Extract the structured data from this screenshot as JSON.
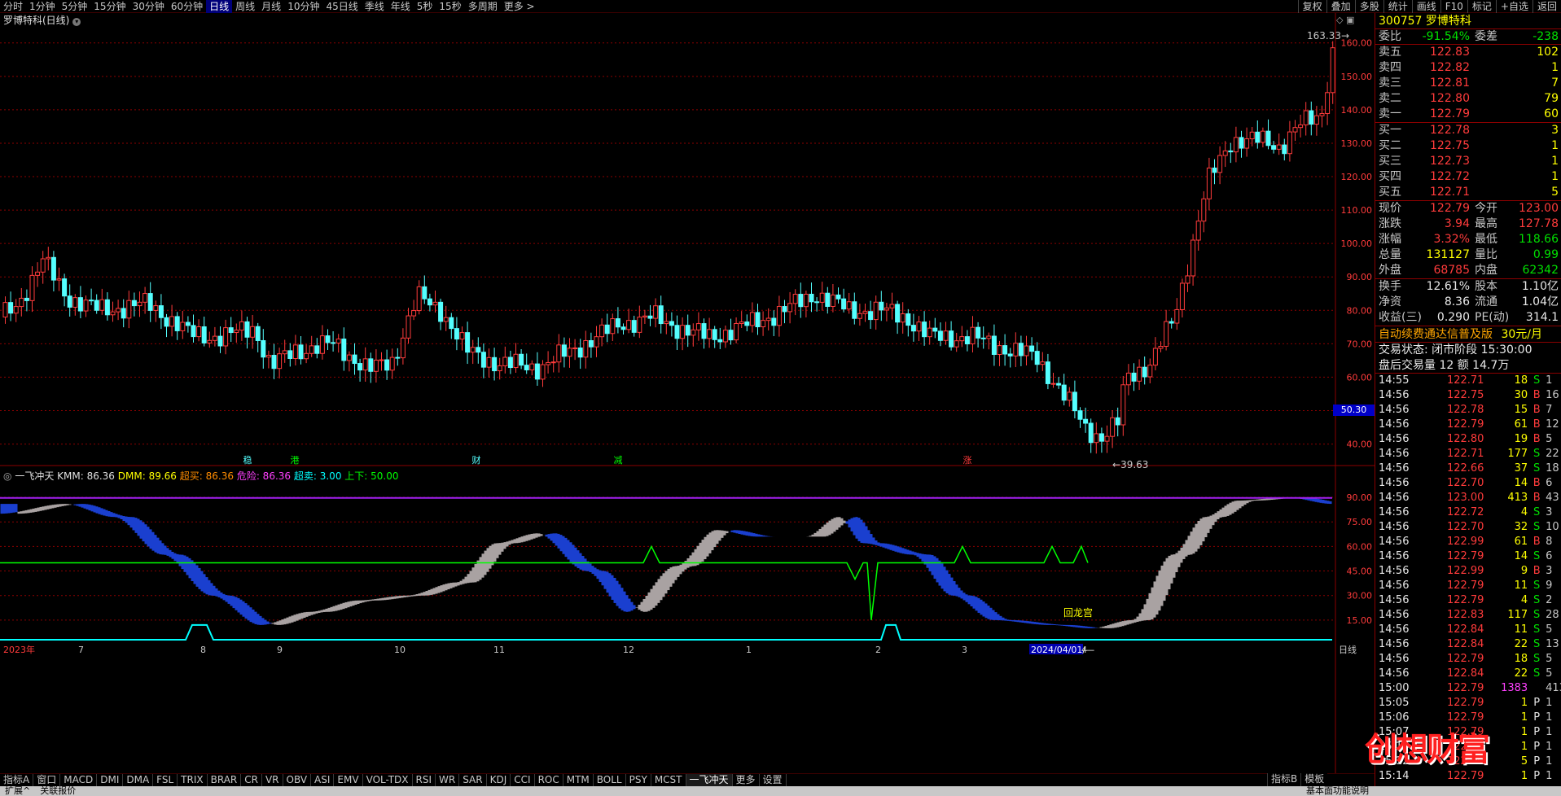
{
  "toolbar": {
    "periods": [
      "分时",
      "1分钟",
      "5分钟",
      "15分钟",
      "30分钟",
      "60分钟",
      "日线",
      "周线",
      "月线",
      "10分钟",
      "45日线",
      "季线",
      "年线",
      "5秒",
      "15秒",
      "多周期",
      "更多 >"
    ],
    "active_period": "日线",
    "tools": [
      "复权",
      "叠加",
      "多股",
      "统计",
      "画线",
      "F10",
      "标记",
      "+自选",
      "返回"
    ]
  },
  "chart": {
    "title": "罗博特科(日线)",
    "high_label": "163.33",
    "low_label": "39.63",
    "current_price_tag": "50.30",
    "y_ticks": [
      "160.00",
      "150.00",
      "140.00",
      "130.00",
      "120.00",
      "110.00",
      "100.00",
      "90.00",
      "80.00",
      "70.00",
      "60.00",
      "50.00",
      "40.00"
    ],
    "event_markers": [
      "稳",
      "港",
      "财",
      "减",
      "涨"
    ],
    "indicator": {
      "name": "一飞冲天",
      "kmm": "KMM: 86.36",
      "dmm": "DMM: 89.66",
      "overbuy": "超买: 86.36",
      "danger": "危险: 86.36",
      "oversell": "超卖: 3.00",
      "updown": "上下: 50.00",
      "y_ticks": [
        "90.00",
        "75.00",
        "60.00",
        "45.00",
        "30.00",
        "15.00"
      ],
      "annotation": "回龙宫"
    },
    "x_labels": [
      "2023年",
      "7",
      "8",
      "9",
      "10",
      "11",
      "12",
      "1",
      "2",
      "3",
      "2024/04/01/—",
      "4"
    ],
    "period_label": "日线"
  },
  "indicator_tabs": [
    "指标A",
    "窗口",
    "MACD",
    "DMI",
    "DMA",
    "FSL",
    "TRIX",
    "BRAR",
    "CR",
    "VR",
    "OBV",
    "ASI",
    "EMV",
    "VOL-TDX",
    "RSI",
    "WR",
    "SAR",
    "KDJ",
    "CCI",
    "ROC",
    "MTM",
    "BOLL",
    "PSY",
    "MCST",
    "一飞冲天",
    "更多",
    "设置"
  ],
  "indicator_tabs_right": [
    "指标B",
    "模板"
  ],
  "status_bar": [
    "扩展^",
    "关联报价"
  ],
  "status_bar_right": "基本面功能说明",
  "quote": {
    "code": "300757",
    "name": "罗博特科",
    "weibi_label": "委比",
    "weibi": "-91.54%",
    "weicha_label": "委差",
    "weicha": "-238",
    "asks": [
      {
        "label": "卖五",
        "price": "122.83",
        "vol": "102"
      },
      {
        "label": "卖四",
        "price": "122.82",
        "vol": "1"
      },
      {
        "label": "卖三",
        "price": "122.81",
        "vol": "7"
      },
      {
        "label": "卖二",
        "price": "122.80",
        "vol": "79"
      },
      {
        "label": "卖一",
        "price": "122.79",
        "vol": "60"
      }
    ],
    "bids": [
      {
        "label": "买一",
        "price": "122.78",
        "vol": "3"
      },
      {
        "label": "买二",
        "price": "122.75",
        "vol": "1"
      },
      {
        "label": "买三",
        "price": "122.73",
        "vol": "1"
      },
      {
        "label": "买四",
        "price": "122.72",
        "vol": "1"
      },
      {
        "label": "买五",
        "price": "122.71",
        "vol": "5"
      }
    ],
    "stats": [
      {
        "l1": "现价",
        "v1": "122.79",
        "c1": "red",
        "l2": "今开",
        "v2": "123.00",
        "c2": "red"
      },
      {
        "l1": "涨跌",
        "v1": "3.94",
        "c1": "red",
        "l2": "最高",
        "v2": "127.78",
        "c2": "red"
      },
      {
        "l1": "涨幅",
        "v1": "3.32%",
        "c1": "red",
        "l2": "最低",
        "v2": "118.66",
        "c2": "green"
      },
      {
        "l1": "总量",
        "v1": "131127",
        "c1": "yellow",
        "l2": "量比",
        "v2": "0.99",
        "c2": "green"
      },
      {
        "l1": "外盘",
        "v1": "68785",
        "c1": "red",
        "l2": "内盘",
        "v2": "62342",
        "c2": "green"
      }
    ],
    "stats2": [
      {
        "l1": "换手",
        "v1": "12.61%",
        "l2": "股本",
        "v2": "1.10亿"
      },
      {
        "l1": "净资",
        "v1": "8.36",
        "l2": "流通",
        "v2": "1.04亿"
      },
      {
        "l1": "收益(三)",
        "v1": "0.290",
        "l2": "PE(动)",
        "v2": "314.1"
      }
    ],
    "promo": "自动续费通达信普及版",
    "promo_price": "30元/月",
    "trade_state": "交易状态: 闭市阶段 15:30:00",
    "after_hours": "盘后交易量 12 额 14.7万"
  },
  "ticks": [
    {
      "t": "14:55",
      "p": "122.71",
      "q": "18",
      "s": "S",
      "n": "1"
    },
    {
      "t": "14:56",
      "p": "122.75",
      "q": "30",
      "s": "B",
      "n": "16"
    },
    {
      "t": "14:56",
      "p": "122.78",
      "q": "15",
      "s": "B",
      "n": "7"
    },
    {
      "t": "14:56",
      "p": "122.79",
      "q": "61",
      "s": "B",
      "n": "12"
    },
    {
      "t": "14:56",
      "p": "122.80",
      "q": "19",
      "s": "B",
      "n": "5"
    },
    {
      "t": "14:56",
      "p": "122.71",
      "q": "177",
      "s": "S",
      "n": "22"
    },
    {
      "t": "14:56",
      "p": "122.66",
      "q": "37",
      "s": "S",
      "n": "18"
    },
    {
      "t": "14:56",
      "p": "122.70",
      "q": "14",
      "s": "B",
      "n": "6"
    },
    {
      "t": "14:56",
      "p": "123.00",
      "q": "413",
      "s": "B",
      "n": "43"
    },
    {
      "t": "14:56",
      "p": "122.72",
      "q": "4",
      "s": "S",
      "n": "3"
    },
    {
      "t": "14:56",
      "p": "122.70",
      "q": "32",
      "s": "S",
      "n": "10"
    },
    {
      "t": "14:56",
      "p": "122.99",
      "q": "61",
      "s": "B",
      "n": "8"
    },
    {
      "t": "14:56",
      "p": "122.79",
      "q": "14",
      "s": "S",
      "n": "6"
    },
    {
      "t": "14:56",
      "p": "122.99",
      "q": "9",
      "s": "B",
      "n": "3"
    },
    {
      "t": "14:56",
      "p": "122.79",
      "q": "11",
      "s": "S",
      "n": "9"
    },
    {
      "t": "14:56",
      "p": "122.79",
      "q": "4",
      "s": "S",
      "n": "2"
    },
    {
      "t": "14:56",
      "p": "122.83",
      "q": "117",
      "s": "S",
      "n": "28"
    },
    {
      "t": "14:56",
      "p": "122.84",
      "q": "11",
      "s": "S",
      "n": "5"
    },
    {
      "t": "14:56",
      "p": "122.84",
      "q": "22",
      "s": "S",
      "n": "13"
    },
    {
      "t": "14:56",
      "p": "122.79",
      "q": "18",
      "s": "S",
      "n": "5"
    },
    {
      "t": "14:56",
      "p": "122.84",
      "q": "22",
      "s": "S",
      "n": "5"
    },
    {
      "t": "15:00",
      "p": "122.79",
      "q": "1383",
      "s": "",
      "n": "413"
    },
    {
      "t": "15:05",
      "p": "122.79",
      "q": "1",
      "s": "P",
      "n": "1"
    },
    {
      "t": "15:06",
      "p": "122.79",
      "q": "1",
      "s": "P",
      "n": "1"
    },
    {
      "t": "15:07",
      "p": "122.79",
      "q": "1",
      "s": "P",
      "n": "1"
    },
    {
      "t": "15:10",
      "p": "122.79",
      "q": "1",
      "s": "P",
      "n": "1"
    },
    {
      "t": "15:12",
      "p": "122.79",
      "q": "5",
      "s": "P",
      "n": "1"
    },
    {
      "t": "15:14",
      "p": "122.79",
      "q": "1",
      "s": "P",
      "n": "1"
    }
  ],
  "watermark": "创想财富",
  "colors": {
    "up": "#ff3b3b",
    "down": "#54ffff",
    "grid": "#8b0000",
    "purple_line": "#a020f0",
    "green_line": "#00ff00",
    "cyan_line": "#00ffff",
    "band_up": "#a9a2a2",
    "band_down": "#1a3fcf"
  }
}
